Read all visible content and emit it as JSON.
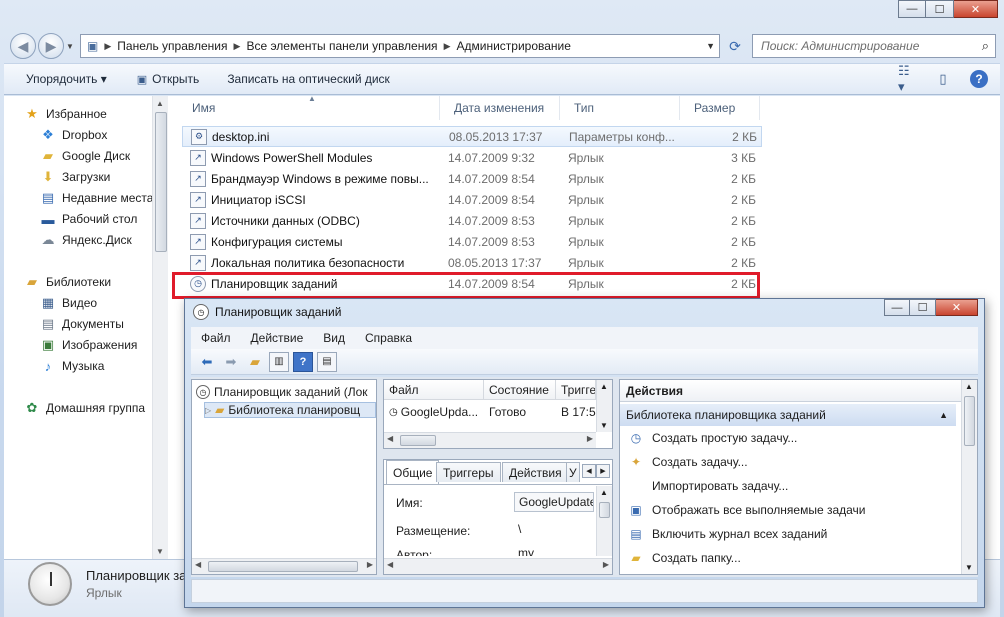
{
  "explorer": {
    "controls": {
      "minimize": "—",
      "maximize": "☐",
      "close": "✕"
    },
    "breadcrumb": [
      "Панель управления",
      "Все элементы панели управления",
      "Администрирование"
    ],
    "search_placeholder": "Поиск: Администрирование",
    "toolbar": {
      "organize": "Упорядочить ▾",
      "open": "Открыть",
      "burn": "Записать на оптический диск"
    },
    "nav": [
      {
        "label": "Избранное",
        "icon": "star-icon"
      },
      {
        "label": "Dropbox",
        "icon": "dropbox-icon"
      },
      {
        "label": "Google Диск",
        "icon": "folder-icon"
      },
      {
        "label": "Загрузки",
        "icon": "downloads-icon"
      },
      {
        "label": "Недавние места",
        "icon": "recent-places-icon"
      },
      {
        "label": "Рабочий стол",
        "icon": "desktop-icon"
      },
      {
        "label": "Яндекс.Диск",
        "icon": "yandex-disk-icon"
      },
      {
        "label": "Библиотеки",
        "icon": "libraries-icon"
      },
      {
        "label": "Видео",
        "icon": "video-icon"
      },
      {
        "label": "Документы",
        "icon": "documents-icon"
      },
      {
        "label": "Изображения",
        "icon": "pictures-icon"
      },
      {
        "label": "Музыка",
        "icon": "music-icon"
      },
      {
        "label": "Домашняя группа",
        "icon": "homegroup-icon"
      }
    ],
    "columns": {
      "name": "Имя",
      "date": "Дата изменения",
      "type": "Тип",
      "size": "Размер"
    },
    "files": [
      {
        "name": "desktop.ini",
        "date": "08.05.2013 17:37",
        "type": "Параметры конф...",
        "size": "2 КБ"
      },
      {
        "name": "Windows PowerShell Modules",
        "date": "14.07.2009 9:32",
        "type": "Ярлык",
        "size": "3 КБ"
      },
      {
        "name": "Брандмауэр Windows в режиме повы...",
        "date": "14.07.2009 8:54",
        "type": "Ярлык",
        "size": "2 КБ"
      },
      {
        "name": "Инициатор iSCSI",
        "date": "14.07.2009 8:54",
        "type": "Ярлык",
        "size": "2 КБ"
      },
      {
        "name": "Источники данных (ODBC)",
        "date": "14.07.2009 8:53",
        "type": "Ярлык",
        "size": "2 КБ"
      },
      {
        "name": "Конфигурация системы",
        "date": "14.07.2009 8:53",
        "type": "Ярлык",
        "size": "2 КБ"
      },
      {
        "name": "Локальная политика безопасности",
        "date": "08.05.2013 17:37",
        "type": "Ярлык",
        "size": "2 КБ"
      },
      {
        "name": "Планировщик заданий",
        "date": "14.07.2009 8:54",
        "type": "Ярлык",
        "size": "2 КБ"
      }
    ],
    "details": {
      "name": "Планировщик задан",
      "type": "Ярлык"
    }
  },
  "scheduler": {
    "title": "Планировщик заданий",
    "menu": [
      "Файл",
      "Действие",
      "Вид",
      "Справка"
    ],
    "tree": {
      "root": "Планировщик заданий (Лок",
      "library": "Библиотека планировщ"
    },
    "grid": {
      "headers": [
        "Файл",
        "Состояние",
        "Тригге"
      ],
      "row": [
        "GoogleUpda...",
        "Готово",
        "В 17:5("
      ]
    },
    "tabs": [
      "Общие",
      "Триггеры",
      "Действия",
      "У"
    ],
    "props": [
      {
        "label": "Имя:",
        "value": "GoogleUpdate"
      },
      {
        "label": "Размещение:",
        "value": "\\"
      },
      {
        "label": "Автор:",
        "value": "my"
      }
    ],
    "actions": {
      "header": "Действия",
      "section": "Библиотека планировщика заданий",
      "items": [
        {
          "label": "Создать простую задачу...",
          "icon": "create-basic-task-icon"
        },
        {
          "label": "Создать задачу...",
          "icon": "create-task-icon"
        },
        {
          "label": "Импортировать задачу...",
          "icon": ""
        },
        {
          "label": "Отображать все выполняемые задачи",
          "icon": "running-tasks-icon"
        },
        {
          "label": "Включить журнал всех заданий",
          "icon": "history-icon"
        },
        {
          "label": "Создать папку...",
          "icon": "folder-icon"
        }
      ]
    }
  }
}
